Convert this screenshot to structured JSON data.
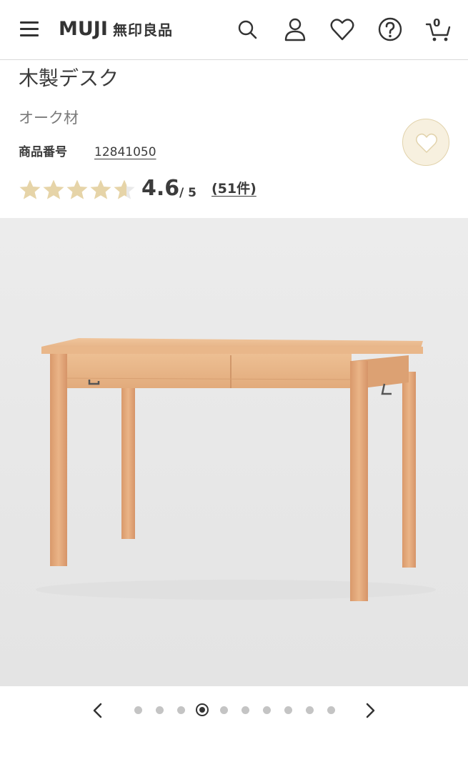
{
  "header": {
    "logo_latin": "MUJI",
    "logo_japanese": "無印良品",
    "menu_icon": "hamburger-menu-icon",
    "search_icon": "search-icon",
    "account_icon": "user-icon",
    "favorites_icon": "heart-icon",
    "help_icon": "help-icon",
    "cart_icon": "cart-icon",
    "cart_count": "0"
  },
  "product": {
    "title": "木製デスク",
    "material": "オーク材",
    "code_label": "商品番号",
    "code_value": "12841050",
    "rating": {
      "value": "4.6",
      "max": "/ 5",
      "stars_value": 4.6,
      "stars_total": 5,
      "reviews": "(51件)"
    },
    "favorite_icon": "heart-outline-icon"
  },
  "gallery": {
    "image_subject": "wooden desk",
    "total_slides": 10,
    "active_slide": 4,
    "prev_icon": "chevron-left-icon",
    "next_icon": "chevron-right-icon"
  },
  "colors": {
    "star_fill": "#e6d4a8",
    "star_empty": "#e9e9e9",
    "favorite_bg": "#f7f0df",
    "wood": "#e2a97a"
  }
}
